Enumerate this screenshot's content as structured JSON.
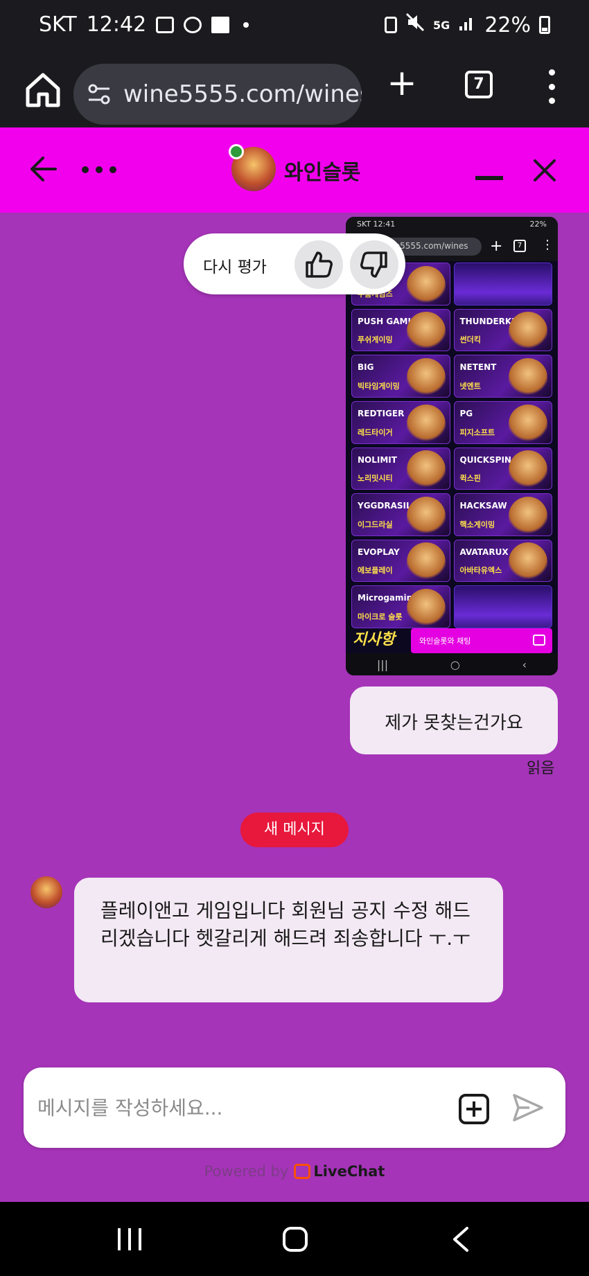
{
  "status_bar": {
    "carrier": "SKT",
    "time": "12:42",
    "network": "5G",
    "battery": "22%"
  },
  "browser": {
    "url": "wine5555.com/wines",
    "tab_count": "7",
    "icons": [
      "home-icon",
      "site-settings-icon",
      "new-tab-icon",
      "tab-switcher-icon",
      "overflow-menu-icon"
    ]
  },
  "chat_header": {
    "agent_name": "와인슬롯",
    "online": true,
    "accent_color": "#f200ee"
  },
  "rating": {
    "label": "다시 평가"
  },
  "shared_screenshot": {
    "status_time": "SKT 12:41",
    "status_battery": "22%",
    "url": "wine5555.com/wines",
    "tab_count": "7",
    "tiles": [
      {
        "logo": "",
        "name": "우훔게임즈"
      },
      {
        "logo": "",
        "name": ""
      },
      {
        "logo": "PUSH GAMING",
        "name": "푸쉬게이밍"
      },
      {
        "logo": "THUNDERKICK",
        "name": "썬더킥"
      },
      {
        "logo": "BIG",
        "name": "빅타임게이밍"
      },
      {
        "logo": "NETENT",
        "name": "넷엔트"
      },
      {
        "logo": "REDTIGER",
        "name": "레드타이거"
      },
      {
        "logo": "PG",
        "name": "피지소프트"
      },
      {
        "logo": "NOLIMIT",
        "name": "노리밋시티"
      },
      {
        "logo": "QUICKSPIN",
        "name": "퀵스핀"
      },
      {
        "logo": "YGGDRASIL",
        "name": "이그드라실"
      },
      {
        "logo": "HACKSAW",
        "name": "핵소게이밍"
      },
      {
        "logo": "EVOPLAY",
        "name": "에보플레이"
      },
      {
        "logo": "AVATARUX",
        "name": "아바타유엑스"
      },
      {
        "logo": "Microgaming",
        "name": "마이크로 슬롯"
      },
      {
        "logo": "",
        "name": ""
      }
    ],
    "notice": "지사항",
    "chat_label": "와인슬롯와 채팅"
  },
  "messages": {
    "user_message": "제가 못찾는건가요",
    "read_receipt": "읽음",
    "new_divider": "새 메시지",
    "agent_message": "플레이앤고 게임입니다 회원님 공지 수정 해드리겠습니다 헷갈리게 해드려 죄송합니다 ㅜ.ㅜ"
  },
  "composer": {
    "placeholder": "메시지를 작성하세요...",
    "value": ""
  },
  "footer": {
    "powered_by": "Powered by",
    "brand": "LiveChat"
  }
}
